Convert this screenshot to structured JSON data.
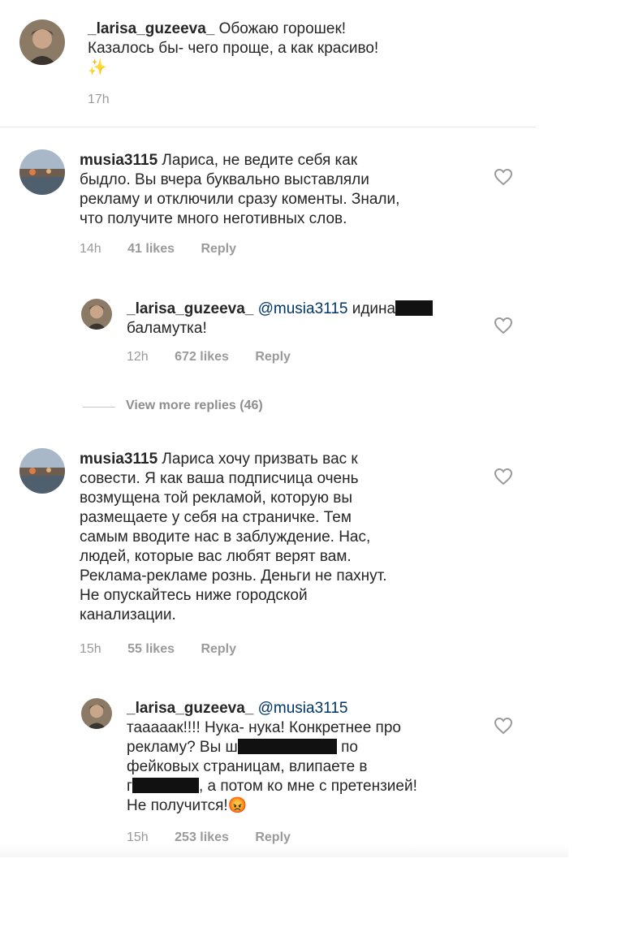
{
  "caption": {
    "username": "_larisa_guzeeva_",
    "text": "Обожаю горошек!",
    "text2": "Казалось бы- чего проще, а как красиво!",
    "emoji": "✨",
    "time": "17h"
  },
  "comments": [
    {
      "username": "musia3115",
      "lines": [
        "Лариса, не ведите себя как",
        "быдло. Вы вчера буквально выставляли",
        "рекламу и отключили сразу коменты. Знали,",
        "что получите много неготивных слов."
      ],
      "time": "14h",
      "likes": "41 likes",
      "reply": "Reply"
    },
    {
      "username": "_larisa_guzeeva_",
      "mention": "@musia3115",
      "text_after_mention": "идина",
      "line2": "баламутка!",
      "time": "12h",
      "likes": "672 likes",
      "reply": "Reply"
    },
    {
      "username": "musia3115",
      "lines": [
        "Лариса хочу призвать вас к",
        "совести. Я как ваша подписчица очень",
        "возмущена той рекламой, которую вы",
        "размещаете у себя на страничке. Тем",
        "самым вводите нас в заблуждение. Нас,",
        "людей, которые вас любят верят вам.",
        "Реклама-рекламе рознь. Деньги не пахнут.",
        "Не опускайтесь ниже городской",
        "канализации."
      ],
      "time": "15h",
      "likes": "55 likes",
      "reply": "Reply"
    },
    {
      "username": "_larisa_guzeeva_",
      "mention": "@musia3115",
      "line1": "таааaак!!!! Нука- нука! Конкретнее про",
      "line2a": "рекламу? Вы ш",
      "line2b": "по",
      "line3": "фейковых страницам, влипаете в",
      "line4a": "г",
      "line4b": ", а потом ко мне с претензией!",
      "line5": "Не получится!",
      "emoji": "😡",
      "time": "15h",
      "likes": "253 likes",
      "reply": "Reply"
    }
  ],
  "view_more": "View more replies (46)",
  "colors": {
    "text": "#262626",
    "meta": "#9a9a9a",
    "mention": "#003569",
    "redaction": "#111111"
  }
}
